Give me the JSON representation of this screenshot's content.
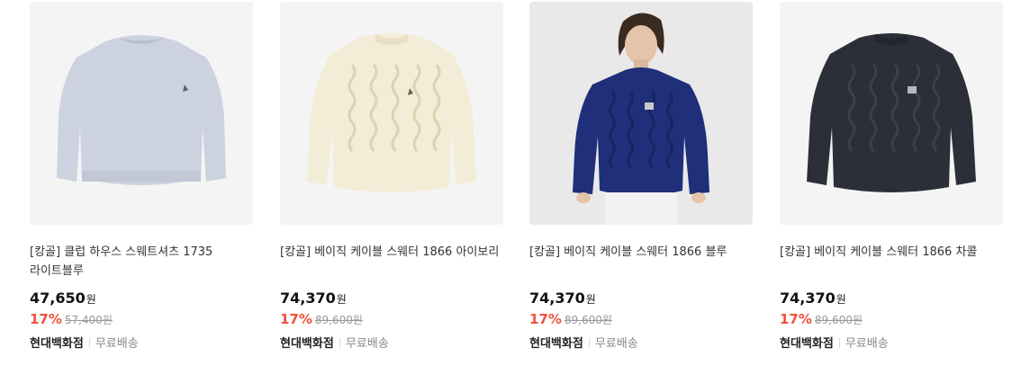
{
  "products": [
    {
      "title": "[캉골] 클럽 하우스 스웨트셔츠 1735 라이트블루",
      "price": "47,650",
      "currency": "원",
      "discount_rate": "17%",
      "original_price": "57,400원",
      "seller": "현대백화점",
      "shipping": "무료배송",
      "image": "light-blue-sweatshirt"
    },
    {
      "title": "[캉골] 베이직 케이블 스웨터 1866 아이보리",
      "price": "74,370",
      "currency": "원",
      "discount_rate": "17%",
      "original_price": "89,600원",
      "seller": "현대백화점",
      "shipping": "무료배송",
      "image": "ivory-cable-sweater"
    },
    {
      "title": "[캉골] 베이직 케이블 스웨터 1866 블루",
      "price": "74,370",
      "currency": "원",
      "discount_rate": "17%",
      "original_price": "89,600원",
      "seller": "현대백화점",
      "shipping": "무료배송",
      "image": "model-wearing-blue-cable-sweater"
    },
    {
      "title": "[캉골] 베이직 케이블 스웨터 1866 차콜",
      "price": "74,370",
      "currency": "원",
      "discount_rate": "17%",
      "original_price": "89,600원",
      "seller": "현대백화점",
      "shipping": "무료배송",
      "image": "charcoal-cable-sweater"
    }
  ],
  "colors": {
    "discount": "#f0513c",
    "ivory": "#f3ecd6",
    "blue": "#1f2f7a",
    "charcoal": "#2c2f38",
    "light_blue": "#cdd2e0"
  }
}
